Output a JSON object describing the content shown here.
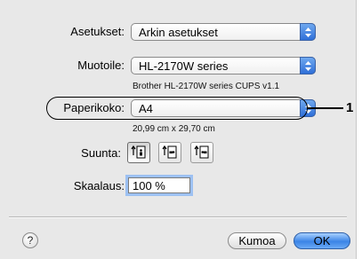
{
  "settings": {
    "label": "Asetukset:",
    "value": "Arkin asetukset"
  },
  "format_for": {
    "label": "Muotoile:",
    "value": "HL-2170W series",
    "sub": "Brother HL-2170W series CUPS v1.1"
  },
  "paper_size": {
    "label": "Paperikoko:",
    "value": "A4",
    "sub": "20,99 cm x 29,70 cm"
  },
  "orientation": {
    "label": "Suunta:",
    "options": [
      {
        "icon": "portrait-orientation-icon",
        "selected": true
      },
      {
        "icon": "landscape-left-orientation-icon",
        "selected": false
      },
      {
        "icon": "landscape-right-orientation-icon",
        "selected": false
      }
    ]
  },
  "scale": {
    "label": "Skaalaus:",
    "value": "100 %"
  },
  "footer": {
    "help": "?",
    "cancel": "Kumoa",
    "ok": "OK"
  },
  "callout": {
    "number": "1"
  },
  "colors": {
    "accent": "#3b84e6",
    "panel": "#e8e8e8"
  }
}
